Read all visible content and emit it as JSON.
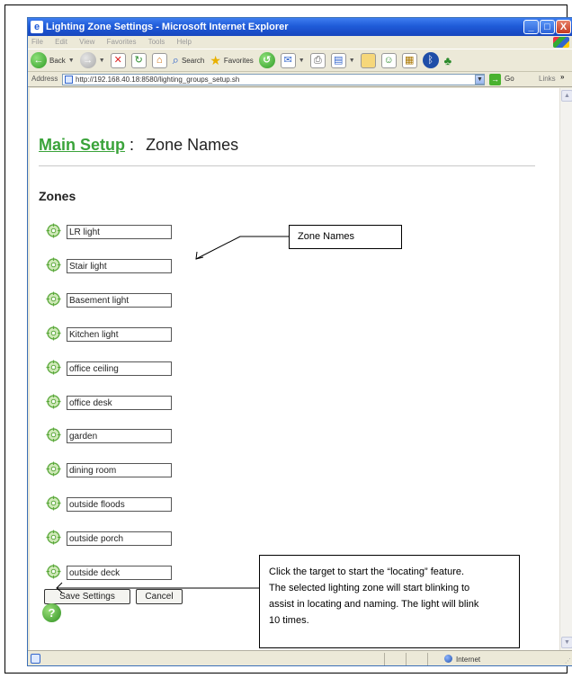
{
  "window": {
    "title": "Lighting Zone Settings - Microsoft Internet Explorer",
    "controls": [
      "_",
      "□",
      "X"
    ]
  },
  "menu": [
    "File",
    "Edit",
    "View",
    "Favorites",
    "Tools",
    "Help"
  ],
  "toolbar": {
    "back_label": "Back",
    "search_label": "Search",
    "favorites_label": "Favorites"
  },
  "address": {
    "label": "Address",
    "url": "http://192.168.40.18:8580/lighting_groups_setup.sh",
    "go_label": "Go",
    "links_label": "Links"
  },
  "page": {
    "main_link": "Main Setup",
    "colon": ":",
    "title": "Zone Names",
    "zones_heading": "Zones",
    "zones": [
      "LR light",
      "Stair light",
      "Basement light",
      "Kitchen light",
      "office ceiling",
      "office desk",
      "garden",
      "dining room",
      "outside floods",
      "outside porch",
      "outside deck"
    ],
    "save_label": "Save Settings",
    "cancel_label": "Cancel",
    "help_icon": "?"
  },
  "annotations": {
    "callout": "Zone Names",
    "note_lines": [
      "Click the target to start the “locating” feature.",
      "The selected lighting zone will start blinking to",
      "assist in locating and naming.  The light will blink",
      "10 times."
    ]
  },
  "status": {
    "zone": "Internet"
  }
}
